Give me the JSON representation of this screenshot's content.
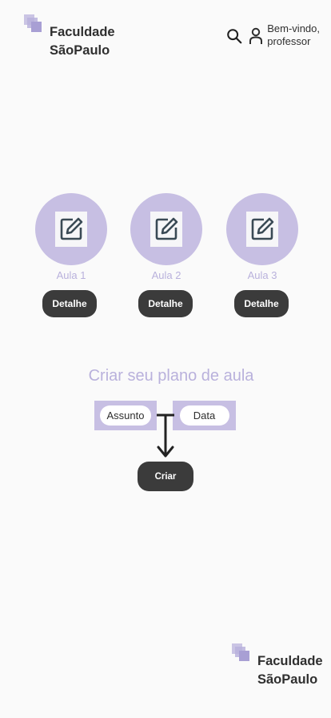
{
  "header": {
    "logo_line1": "Faculdade",
    "logo_line2": "SãoPaulo",
    "welcome_line1": "Bem-vindo,",
    "welcome_line2": "professor"
  },
  "aulas": [
    {
      "label": "Aula 1",
      "button": "Detalhe",
      "icon": "edit-note-icon"
    },
    {
      "label": "Aula 2",
      "button": "Detalhe",
      "icon": "edit-note-icon"
    },
    {
      "label": "Aula 3",
      "button": "Detalhe",
      "icon": "edit-note-icon"
    }
  ],
  "plano": {
    "title": "Criar seu plano de aula",
    "assunto_label": "Assunto",
    "data_label": "Data",
    "criar_button": "Criar"
  },
  "footer": {
    "logo_line1": "Faculdade",
    "logo_line2": "SãoPaulo"
  },
  "colors": {
    "accent_lavender": "#c7bfe3",
    "label_lavender": "#b9b1dc",
    "button_dark": "#3b3b3b",
    "background": "#fafafa"
  }
}
